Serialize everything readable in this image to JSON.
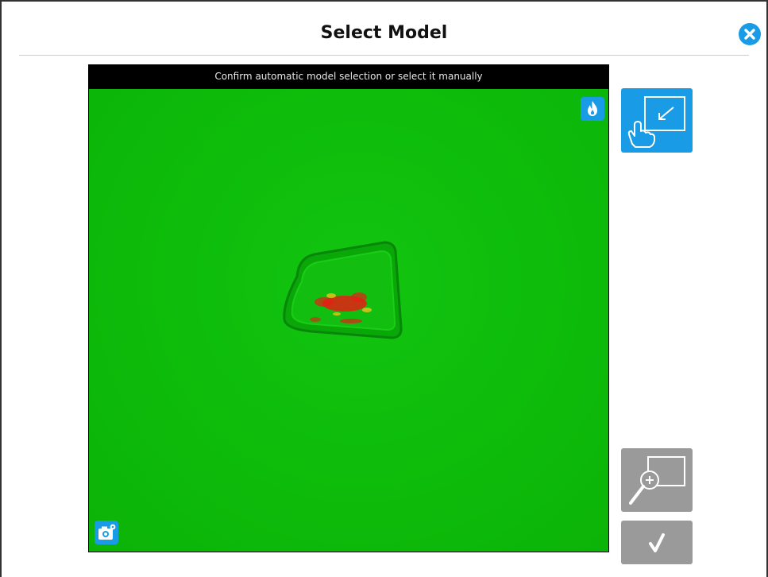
{
  "dialog": {
    "title": "Select Model",
    "close_icon": "close-icon"
  },
  "viewer": {
    "banner": "Confirm automatic model selection or select it manually",
    "hot_icon": "flame-icon",
    "camera_settings_icon": "camera-settings-icon"
  },
  "actions": {
    "select_region_icon": "hand-select-region-icon",
    "zoom_icon": "zoom-in-icon",
    "confirm_icon": "checkmark-icon"
  },
  "colors": {
    "accent": "#1a9be6",
    "disabled": "#9a9a9a",
    "image_green": "#0ebd0b",
    "highlight_red": "#e81d14"
  }
}
